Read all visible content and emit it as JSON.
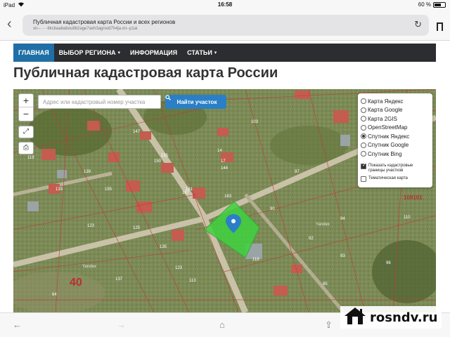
{
  "status_bar": {
    "device": "iPad",
    "time": "16:58",
    "battery": "60 %"
  },
  "browser": {
    "page_title": "Публичная кадастровая карта России и всех регионов",
    "url": "xn--·····6kcbaababou8b2age7axh3agnxid7h4ja.xn--p1ai"
  },
  "site_nav": {
    "items": [
      {
        "label": "ГЛАВНАЯ",
        "active": true,
        "dropdown": false
      },
      {
        "label": "ВЫБОР РЕГИОНА",
        "active": false,
        "dropdown": true
      },
      {
        "label": "ИНФОРМАЦИЯ",
        "active": false,
        "dropdown": false
      },
      {
        "label": "СТАТЬИ",
        "active": false,
        "dropdown": true
      }
    ]
  },
  "page": {
    "title": "Публичная кадастровая карта России"
  },
  "map": {
    "search_placeholder": "Адрес или кадастровый номер участка",
    "search_button": "Найти участок",
    "zoom_in": "+",
    "zoom_out": "−",
    "layers": [
      {
        "label": "Карта Яндекс",
        "checked": false
      },
      {
        "label": "Карта Google",
        "checked": false
      },
      {
        "label": "Карта 2GIS",
        "checked": false
      },
      {
        "label": "OpenStreetMap",
        "checked": false
      },
      {
        "label": "Спутник Яндекс",
        "checked": true
      },
      {
        "label": "Спутник Google",
        "checked": false
      },
      {
        "label": "Спутник Bing",
        "checked": false
      }
    ],
    "options": [
      {
        "label": "Показать кадастровые границы участков",
        "checked": true
      },
      {
        "label": "Тематическая карта",
        "checked": false
      }
    ],
    "labels": {
      "big_number": "40",
      "quarter_code": "109101",
      "yandex1": "Yandex",
      "yandex2": "Yandex",
      "parcel_numbers": [
        "103",
        "14",
        "147",
        "155",
        "150",
        "155",
        "187",
        "144",
        "163",
        "90",
        "97",
        "92",
        "93",
        "119",
        "118",
        "135",
        "137",
        "113",
        "123",
        "133",
        "125",
        "17",
        "123",
        "161",
        "94",
        "110",
        "85",
        "64",
        "96",
        "139"
      ]
    },
    "colors": {
      "selected_parcel": "#3fd23f",
      "marker": "#2a7fc7",
      "boundary": "#c23a3a"
    }
  },
  "watermark": {
    "text": "rosndv.ru"
  }
}
